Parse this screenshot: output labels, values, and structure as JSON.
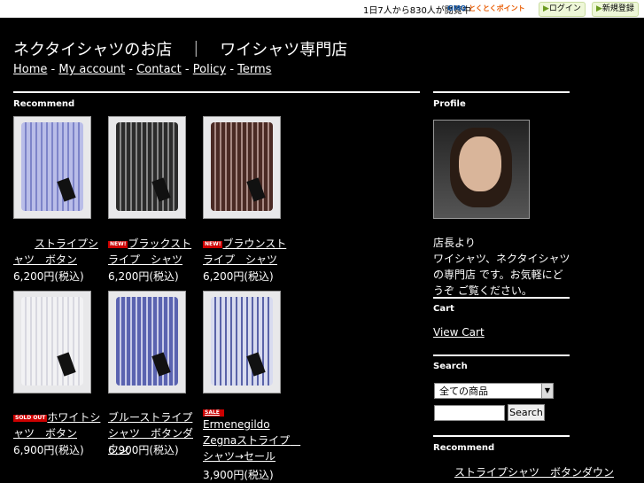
{
  "topbar": {
    "count_text": "1日7人から830人が閲覧中",
    "gmo_label": "GMO",
    "gmo_points": "とくとくポイント",
    "login_label": "ログイン",
    "register_label": "新規登録"
  },
  "site": {
    "title": "ネクタイシャツのお店　｜　ワイシャツ専門店"
  },
  "nav": {
    "home": "Home",
    "account": "My account",
    "contact": "Contact",
    "policy": "Policy",
    "terms": "Terms",
    "sep": "-"
  },
  "main": {
    "heading": "Recommend",
    "products": [
      {
        "title": "ストライプシャツ　ボタン",
        "price": "6,200円(税込)",
        "badge": "plain",
        "colors": [
          "#b9bde8",
          "#7d84c9"
        ]
      },
      {
        "title": "ブラックストライプ　シャツ",
        "price": "6,200円(税込)",
        "badge": "NEW!",
        "colors": [
          "#2b2b2b",
          "#888888"
        ]
      },
      {
        "title": "ブラウンストライプ　シャツ",
        "price": "6,200円(税込)",
        "badge": "NEW!",
        "colors": [
          "#4a2a24",
          "#a88a84"
        ]
      },
      {
        "title": "ホワイトシャツ　ボタン",
        "price": "6,900円(税込)",
        "badge": "SOLD OUT",
        "colors": [
          "#f2f2f4",
          "#d8d8e0"
        ]
      },
      {
        "title": "ブルーストライプシャツ　ボタンダウン",
        "price": "6,900円(税込)",
        "badge": "",
        "colors": [
          "#5a63b0",
          "#c8cbe8"
        ]
      },
      {
        "title": "Ermenegildo Zegnaストライプ　シャツ→セール",
        "price": "3,900円(税込)",
        "badge": "SALE",
        "colors": [
          "#d8dbef",
          "#5a63a8"
        ]
      }
    ]
  },
  "sidebar": {
    "profile_heading": "Profile",
    "profile_name": "店長より",
    "profile_text": "ワイシャツ、ネクタイシャツの専門店 です。お気軽にどうぞ ご覧ください。",
    "cart_heading": "Cart",
    "view_cart": "View Cart",
    "search_heading": "Search",
    "search_select": "全ての商品",
    "search_placeholder": "",
    "search_button": "Search",
    "recommend_heading": "Recommend",
    "recommend_item": "ストライプシャツ　ボタンダウン"
  }
}
